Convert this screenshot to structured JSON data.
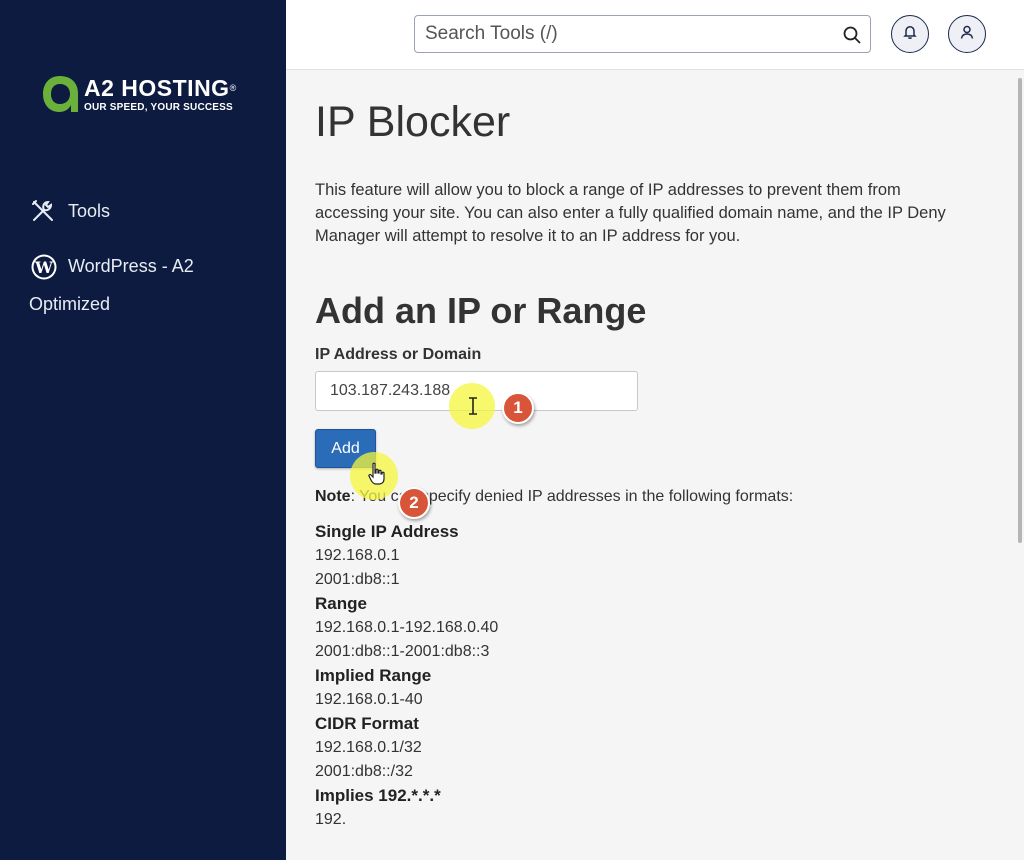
{
  "brand": {
    "name": "A2 HOSTING",
    "registered": "®",
    "tagline": "OUR SPEED, YOUR SUCCESS",
    "colors": {
      "primary": "#0c1b3f",
      "logo_green": "#6ab03b",
      "accent": "#2b6cb8",
      "badge": "#d9553a"
    }
  },
  "sidebar": {
    "items": [
      {
        "label": "Tools",
        "icon": "tools-icon"
      },
      {
        "label": "WordPress - A2",
        "label_cont": "Optimized",
        "icon": "wordpress-icon"
      }
    ]
  },
  "header": {
    "search_placeholder": "Search Tools (/)",
    "icons": [
      "search-icon",
      "bell-icon",
      "user-icon"
    ]
  },
  "main": {
    "title": "IP Blocker",
    "intro": "This feature will allow you to block a range of IP addresses to prevent them from accessing your site. You can also enter a fully qualified domain name, and the IP Deny Manager will attempt to resolve it to an IP address for you.",
    "section_title": "Add an IP or Range",
    "field_label": "IP Address or Domain",
    "field_value": "103.187.243.188",
    "add_label": "Add",
    "note_label": "Note",
    "note_text": ": You can specify denied IP addresses in the following formats:",
    "formats": [
      {
        "heading": "Single IP Address",
        "examples": [
          "192.168.0.1",
          "2001:db8::1"
        ]
      },
      {
        "heading": "Range",
        "examples": [
          "192.168.0.1-192.168.0.40",
          "2001:db8::1-2001:db8::3"
        ]
      },
      {
        "heading": "Implied Range",
        "examples": [
          "192.168.0.1-40"
        ]
      },
      {
        "heading": "CIDR Format",
        "examples": [
          "192.168.0.1/32",
          "2001:db8::/32"
        ]
      },
      {
        "heading": "Implies 192.*.*.*",
        "examples": [
          "192."
        ]
      }
    ]
  },
  "annotations": {
    "step1": "1",
    "step2": "2"
  }
}
